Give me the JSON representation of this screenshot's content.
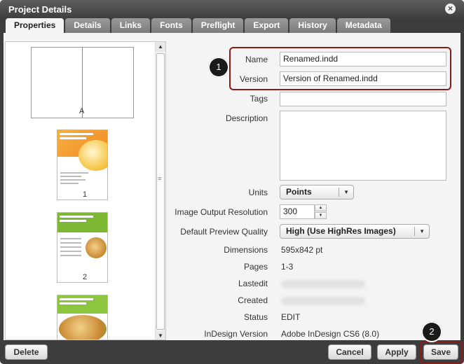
{
  "window": {
    "title": "Project Details",
    "close_glyph": "×"
  },
  "tabs": [
    {
      "label": "Properties",
      "active": true
    },
    {
      "label": "Details"
    },
    {
      "label": "Links"
    },
    {
      "label": "Fonts"
    },
    {
      "label": "Preflight"
    },
    {
      "label": "Export"
    },
    {
      "label": "History"
    },
    {
      "label": "Metadata"
    }
  ],
  "thumbnails": {
    "spread_label": "A",
    "pages": [
      {
        "number": "1",
        "heading": "orange-cover"
      },
      {
        "number": "2",
        "heading": "green-recipe"
      },
      {
        "number": "3",
        "heading": "lime-shrimp"
      }
    ],
    "scroll_grip": "≡"
  },
  "form": {
    "name": {
      "label": "Name",
      "value": "Renamed.indd"
    },
    "version": {
      "label": "Version",
      "value": "Version of Renamed.indd"
    },
    "tags": {
      "label": "Tags",
      "value": ""
    },
    "description": {
      "label": "Description",
      "value": ""
    },
    "units": {
      "label": "Units",
      "value": "Points"
    },
    "resolution": {
      "label": "Image Output Resolution",
      "value": "300"
    },
    "preview_quality": {
      "label": "Default Preview Quality",
      "value": "High (Use HighRes Images)"
    },
    "dimensions": {
      "label": "Dimensions",
      "value": "595x842 pt"
    },
    "pages": {
      "label": "Pages",
      "value": "1-3"
    },
    "lastedit": {
      "label": "Lastedit"
    },
    "created": {
      "label": "Created"
    },
    "status": {
      "label": "Status",
      "value": "EDIT"
    },
    "indesign_version": {
      "label": "InDesign Version",
      "value": "Adobe InDesign CS6 (8.0)"
    }
  },
  "annotations": {
    "badge1": "1",
    "badge2": "2",
    "color": "#8b1a1a"
  },
  "footer": {
    "delete_label": "Delete",
    "cancel_label": "Cancel",
    "apply_label": "Apply",
    "save_label": "Save"
  },
  "icons": {
    "scroll_up": "▲",
    "scroll_down": "▼",
    "dropdown": "▼",
    "spin_up": "▲",
    "spin_down": "▼"
  }
}
